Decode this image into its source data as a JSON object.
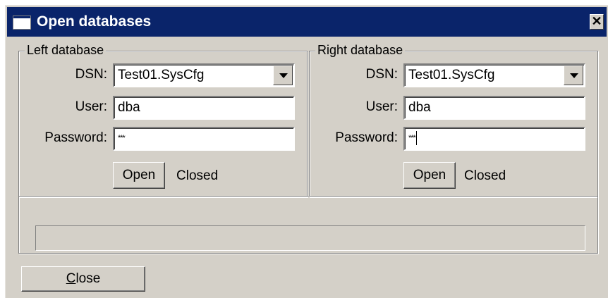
{
  "window": {
    "title": "Open databases",
    "close_glyph": "✕"
  },
  "left": {
    "legend": "Left database",
    "dsn_label": "DSN:",
    "dsn_value": "Test01.SysCfg",
    "user_label": "User:",
    "user_value": "dba",
    "password_label": "Password:",
    "password_value": "***",
    "open_label": "Open",
    "status": "Closed"
  },
  "right": {
    "legend": "Right database",
    "dsn_label": "DSN:",
    "dsn_value": "Test01.SysCfg",
    "user_label": "User:",
    "user_value": "dba",
    "password_label": "Password:",
    "password_value": "***",
    "open_label": "Open",
    "status": "Closed"
  },
  "footer": {
    "close_label_first": "C",
    "close_label_rest": "lose"
  },
  "icons": {
    "window": "window-icon",
    "close": "close-icon",
    "dropdown": "chevron-down-icon"
  }
}
